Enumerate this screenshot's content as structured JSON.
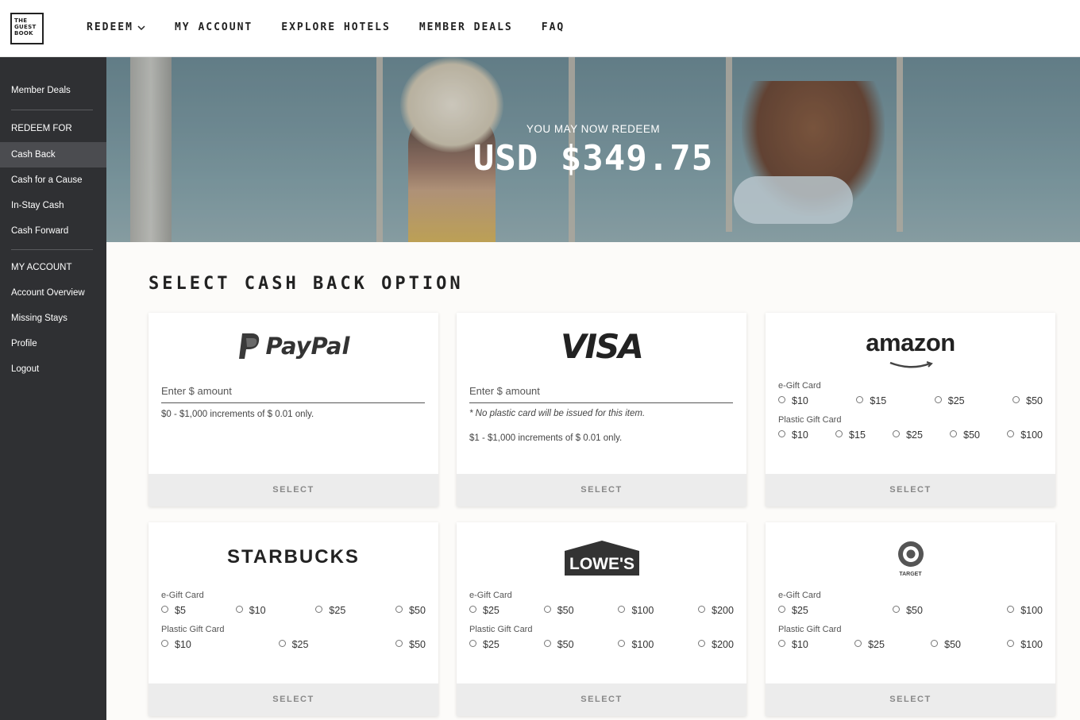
{
  "logo": {
    "line1": "THE",
    "line2": "GUEST",
    "line3": "BOOK"
  },
  "nav": [
    {
      "label": "REDEEM"
    },
    {
      "label": "MY ACCOUNT"
    },
    {
      "label": "EXPLORE HOTELS"
    },
    {
      "label": "MEMBER DEALS"
    },
    {
      "label": "FAQ"
    }
  ],
  "sidebar": {
    "member_deals": "Member Deals",
    "redeem_heading": "REDEEM FOR",
    "redeem_items": [
      "Cash Back",
      "Cash for a Cause",
      "In-Stay Cash",
      "Cash Forward"
    ],
    "account_heading": "MY ACCOUNT",
    "account_items": [
      "Account Overview",
      "Missing Stays",
      "Profile",
      "Logout"
    ]
  },
  "hero": {
    "subtitle": "YOU MAY NOW REDEEM",
    "amount": "USD $349.75"
  },
  "section_title": "SELECT CASH BACK OPTION",
  "select_label": "SELECT",
  "cards": {
    "paypal": {
      "brand": "PayPal",
      "placeholder": "Enter $ amount",
      "note": "$0 - $1,000 increments of $ 0.01 only."
    },
    "visa": {
      "brand": "VISA",
      "placeholder": "Enter $ amount",
      "disclaimer": "* No plastic card will be issued for this item.",
      "note": "$1 - $1,000 increments of $ 0.01 only."
    },
    "amazon": {
      "brand": "amazon",
      "egift_label": "e-Gift Card",
      "egift": [
        "$10",
        "$15",
        "$25",
        "$50"
      ],
      "plastic_label": "Plastic Gift Card",
      "plastic": [
        "$10",
        "$15",
        "$25",
        "$50",
        "$100"
      ]
    },
    "starbucks": {
      "brand": "STARBUCKS",
      "egift_label": "e-Gift Card",
      "egift": [
        "$5",
        "$10",
        "$25",
        "$50"
      ],
      "plastic_label": "Plastic Gift Card",
      "plastic": [
        "$10",
        "$25",
        "$50"
      ]
    },
    "lowes": {
      "brand": "LOWE'S",
      "egift_label": "e-Gift Card",
      "egift": [
        "$25",
        "$50",
        "$100",
        "$200"
      ],
      "plastic_label": "Plastic Gift Card",
      "plastic": [
        "$25",
        "$50",
        "$100",
        "$200"
      ]
    },
    "target": {
      "brand": "TARGET",
      "egift_label": "e-Gift Card",
      "egift": [
        "$25",
        "$50",
        "$100"
      ],
      "plastic_label": "Plastic Gift Card",
      "plastic": [
        "$10",
        "$25",
        "$50",
        "$100"
      ]
    }
  }
}
